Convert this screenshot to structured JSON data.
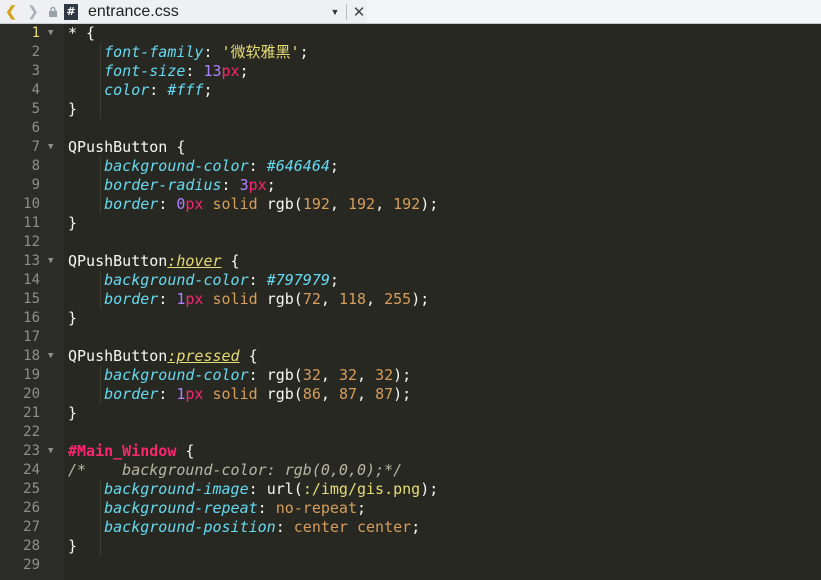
{
  "tab": {
    "filename": "entrance.css",
    "back_icon": "chevron-left-icon",
    "forward_icon": "chevron-right-icon",
    "lock_icon": "lock-icon",
    "file_icon_glyph": "#",
    "dropdown_glyph": "▼",
    "close_glyph": "✕"
  },
  "gutter": {
    "active_line": 1,
    "line_numbers": [
      "1",
      "2",
      "3",
      "4",
      "5",
      "6",
      "7",
      "8",
      "9",
      "10",
      "11",
      "12",
      "13",
      "14",
      "15",
      "16",
      "17",
      "18",
      "19",
      "20",
      "21",
      "22",
      "23",
      "24",
      "25",
      "26",
      "27",
      "28",
      "29"
    ],
    "fold_markers": [
      "▼",
      "",
      "",
      "",
      "",
      "",
      "▼",
      "",
      "",
      "",
      "",
      "",
      "▼",
      "",
      "",
      "",
      "",
      "▼",
      "",
      "",
      "",
      "",
      "▼",
      "",
      "",
      "",
      "",
      "",
      ""
    ]
  },
  "code": {
    "l1_sel": "*",
    "l1_brace": " {",
    "l2_prop": "font-family",
    "l2_colon": ": ",
    "l2_val": "'微软雅黑'",
    "l2_end": ";",
    "l3_prop": "font-size",
    "l3_colon": ": ",
    "l3_num": "13",
    "l3_unit": "px",
    "l3_end": ";",
    "l4_prop": "color",
    "l4_colon": ": ",
    "l4_val": "#fff",
    "l4_end": ";",
    "l5": "}",
    "l7_sel": "QPushButton",
    "l7_brace": " {",
    "l8_prop": "background-color",
    "l8_colon": ": ",
    "l8_val": "#646464",
    "l8_end": ";",
    "l9_prop": "border-radius",
    "l9_colon": ": ",
    "l9_num": "3",
    "l9_unit": "px",
    "l9_end": ";",
    "l10_prop": "border",
    "l10_colon": ": ",
    "l10_num": "0",
    "l10_unit": "px",
    "l10_kw": " solid ",
    "l10_fn": "rgb(",
    "l10_a": "192",
    "l10_c1": ", ",
    "l10_b": "192",
    "l10_c2": ", ",
    "l10_c": "192",
    "l10_close": ")",
    "l10_end": ";",
    "l11": "}",
    "l13_sel": "QPushButton",
    "l13_pseudo": ":hover",
    "l13_brace": " {",
    "l14_prop": "background-color",
    "l14_colon": ": ",
    "l14_val": "#797979",
    "l14_end": ";",
    "l15_prop": "border",
    "l15_colon": ": ",
    "l15_num": "1",
    "l15_unit": "px",
    "l15_kw": " solid ",
    "l15_fn": "rgb(",
    "l15_a": "72",
    "l15_c1": ", ",
    "l15_b": "118",
    "l15_c2": ", ",
    "l15_c": "255",
    "l15_close": ")",
    "l15_end": ";",
    "l16": "}",
    "l18_sel": "QPushButton",
    "l18_pseudo": ":pressed",
    "l18_brace": " {",
    "l19_prop": "background-color",
    "l19_colon": ": ",
    "l19_fn": "rgb(",
    "l19_a": "32",
    "l19_c1": ", ",
    "l19_b": "32",
    "l19_c2": ", ",
    "l19_c": "32",
    "l19_close": ")",
    "l19_end": ";",
    "l20_prop": "border",
    "l20_colon": ": ",
    "l20_num": "1",
    "l20_unit": "px",
    "l20_kw": " solid ",
    "l20_fn": "rgb(",
    "l20_a": "86",
    "l20_c1": ", ",
    "l20_b": "87",
    "l20_c2": ", ",
    "l20_c": "87",
    "l20_close": ")",
    "l20_end": ";",
    "l21": "}",
    "l23_sel": "#Main_Window",
    "l23_brace": " {",
    "l24_comment": "/*    background-color: rgb(0,0,0);*/",
    "l25_prop": "background-image",
    "l25_colon": ": ",
    "l25_fn": "url(",
    "l25_val": ":/img/gis.png",
    "l25_close": ")",
    "l25_end": ";",
    "l26_prop": "background-repeat",
    "l26_colon": ": ",
    "l26_val": "no-repeat",
    "l26_end": ";",
    "l27_prop": "background-position",
    "l27_colon": ": ",
    "l27_val": "center center",
    "l27_end": ";",
    "l28": "}"
  },
  "colors": {
    "background": "#272822",
    "gutter": "#2b2c27",
    "property": "#66d9ef",
    "string": "#e6db74",
    "number": "#ae81ff",
    "unit": "#f92672",
    "selector_id": "#f92672"
  }
}
